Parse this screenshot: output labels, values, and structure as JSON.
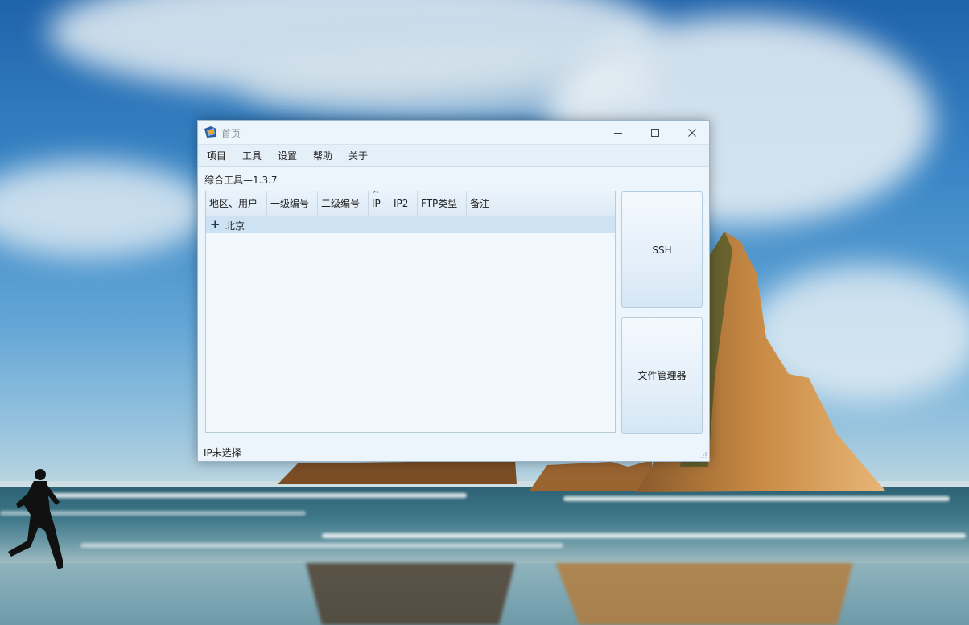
{
  "window": {
    "title": "首页",
    "controls": {
      "minimize": "minimize-icon",
      "maximize": "maximize-icon",
      "close": "close-icon"
    }
  },
  "menu": {
    "items": [
      "项目",
      "工具",
      "设置",
      "帮助",
      "关于"
    ]
  },
  "version_label": "综合工具—1.3.7",
  "table": {
    "columns": [
      "地区、用户",
      "一级编号",
      "二级编号",
      "IP",
      "IP2",
      "FTP类型",
      "备注"
    ],
    "sorted_column": "IP",
    "rows": [
      {
        "expander": "+",
        "label": "北京"
      }
    ]
  },
  "buttons": {
    "ssh": "SSH",
    "file_manager": "文件管理器"
  },
  "status": "IP未选择",
  "colors": {
    "window_bg": "#ecf5fc",
    "selected_row": "#cde2f3",
    "title_text": "#8a929a"
  }
}
